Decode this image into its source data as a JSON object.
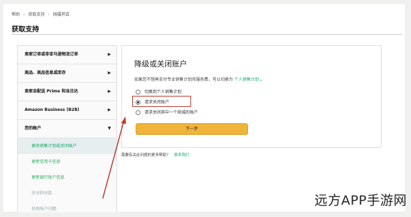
{
  "breadcrumb": [
    "帮助",
    "获取支持",
    "拍摄开店"
  ],
  "page_title": "获取支持",
  "sidebar": {
    "items": [
      {
        "label": "卖家订单或非亚马逊物流订单"
      },
      {
        "label": "商品、商品信息或库存"
      },
      {
        "label": "卖家自配送 Prime 和当日达"
      },
      {
        "label": "Amazon Business (B2B)"
      },
      {
        "label": "您的账户"
      }
    ],
    "subitems": [
      {
        "label": "更改销售计划或关闭账户"
      },
      {
        "label": "更新信用卡信息"
      },
      {
        "label": "更新银行账户信息"
      },
      {
        "label": "支付和付款"
      },
      {
        "label": "其他账户问题"
      }
    ]
  },
  "card": {
    "title": "降级或关闭账户",
    "desc_prefix": "如果您不想再支付专业销售计划月服务费，可以切换为",
    "desc_link": "个人销售计划",
    "desc_suffix": "。",
    "options": [
      {
        "label": "切换到个人销售计划",
        "checked": false
      },
      {
        "label": "请求关闭账户",
        "checked": true
      },
      {
        "label": "请求关闭其中一个商城的账户",
        "checked": false
      }
    ],
    "next_label": "下一步"
  },
  "help": {
    "text": "需要有关此问题的更多帮助？",
    "link": "联系我们"
  },
  "watermark": "远方APP手游网",
  "colors": {
    "accent_button": "#f0b43a",
    "highlight_box": "#c0392b",
    "link": "#11aa77"
  }
}
